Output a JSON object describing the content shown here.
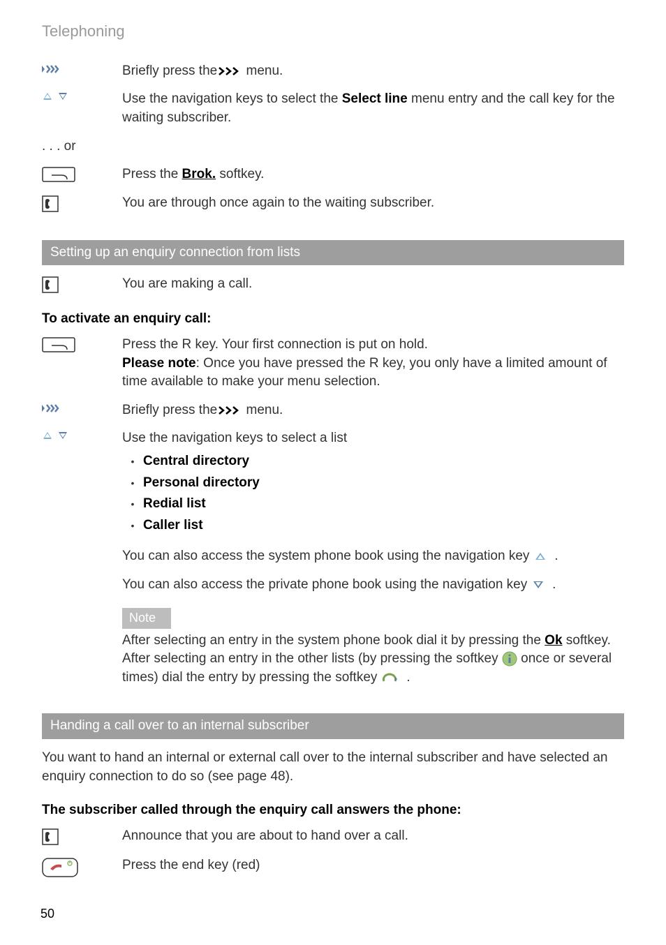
{
  "header": "Telephoning",
  "step1": "menu.",
  "step1_prefix": "Briefly press the",
  "step2_prefix": "Use the navigation keys to select the ",
  "step2_bold": "Select line",
  "step2_suffix": " menu entry and the call key for the waiting subscriber.",
  "or": ". . . or",
  "step3_prefix": "Press the ",
  "step3_link": "Brok.",
  "step3_suffix": " softkey.",
  "step4": "You are through once again to the waiting subscriber.",
  "section1_title": "Setting up an enquiry connection from lists",
  "s1_step1": "You are making a call.",
  "s1_subheading": "To activate an enquiry call:",
  "s1_step2_line1": "Press the R key. Your first connection is put on hold.",
  "s1_step2_bold": "Please note",
  "s1_step2_line2": ": Once you have pressed the R key, you only have a limited amount of time available to make your menu selection.",
  "s1_step3_prefix": "Briefly press the",
  "s1_step3_suffix": "menu.",
  "s1_step4": "Use the navigation keys to select a list",
  "s1_list": {
    "item1": "Central directory",
    "item2": "Personal directory",
    "item3": "Redial list",
    "item4": "Caller list"
  },
  "s1_access1": "You can also access the system phone book using the navigation key",
  "s1_access2": "You can also access the private phone book using the navigation key",
  "note_label": "Note",
  "note_line1_prefix": "After selecting an entry in the system phone book dial it by pressing the ",
  "note_line1_link": "Ok",
  "note_line1_suffix": " softkey. After selecting an entry in the other lists (by pressing the softkey ",
  "note_line1_tail": " once or several times) dial the entry by pressing the softkey ",
  "section2_title": "Handing a call over to an internal subscriber",
  "s2_para": "You want to hand an internal or external call over to the internal subscriber and have selected an enquiry connection to do so (see page 48).",
  "s2_subheading": "The subscriber called through the enquiry call answers the phone:",
  "s2_step1": "Announce that you are about to hand over a call.",
  "s2_step2": "Press the end key (red)",
  "page_number": "50"
}
